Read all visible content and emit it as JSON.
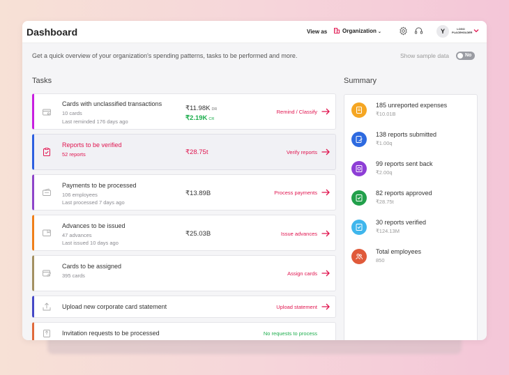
{
  "header": {
    "title": "Dashboard",
    "view_as_label": "View as",
    "org_select_value": "Organization",
    "avatar_initial": "Y",
    "logo_text_top": "LOGO",
    "logo_text_bottom": "PLACEHOLDER"
  },
  "intro": {
    "subtitle": "Get a quick overview of your organization's spending patterns, tasks to be performed and more.",
    "sample_data_label": "Show sample data",
    "sample_toggle_text": "No"
  },
  "tasks": {
    "title": "Tasks",
    "items": [
      {
        "title": "Cards with unclassified transactions",
        "line1": "10 cards",
        "line2": "Last reminded 176 days ago",
        "amount": "₹11.98K",
        "amount_suffix": "DR",
        "amount2": "₹2.19K",
        "amount2_suffix": "CR",
        "action": "Remind / Classify",
        "accent": "#c81ee0",
        "icon": "card-icon"
      },
      {
        "title": "Reports to be verified",
        "line1": "52 reports",
        "amount": "₹28.75t",
        "action": "Verify reports",
        "accent": "#2d5fe0",
        "icon": "clipboard-check-icon"
      },
      {
        "title": "Payments to be processed",
        "line1": "106 employees",
        "line2": "Last processed 7 days ago",
        "amount": "₹13.89B",
        "action": "Process payments",
        "accent": "#8e44c9",
        "icon": "wallet-icon"
      },
      {
        "title": "Advances to be issued",
        "line1": "47 advances",
        "line2": "Last issued 10 days ago",
        "amount": "₹25.03B",
        "action": "Issue advances",
        "accent": "#ef7f1a",
        "icon": "advance-icon"
      },
      {
        "title": "Cards to be assigned",
        "line1": "395 cards",
        "action": "Assign cards",
        "accent": "#a39061",
        "icon": "card-edit-icon"
      },
      {
        "title": "Upload new corporate card statement",
        "action": "Upload statement",
        "accent": "#4548c6",
        "icon": "upload-icon"
      },
      {
        "title": "Invitation requests to be processed",
        "action": "No requests to process",
        "action_color": "#1eae4e",
        "accent": "#e06a3c",
        "icon": "invite-icon"
      }
    ]
  },
  "summary": {
    "title": "Summary",
    "items": [
      {
        "label": "185 unreported expenses",
        "value": "₹10.01B",
        "color": "#f5a623",
        "icon": "receipt-icon"
      },
      {
        "label": "138 reports submitted",
        "value": "₹1.00q",
        "color": "#2d6ae0",
        "icon": "report-submit-icon"
      },
      {
        "label": "99 reports sent back",
        "value": "₹2.00q",
        "color": "#8e3ed6",
        "icon": "report-back-icon"
      },
      {
        "label": "82 reports approved",
        "value": "₹28.75t",
        "color": "#22a04b",
        "icon": "report-approved-icon"
      },
      {
        "label": "30 reports verified",
        "value": "₹124.13M",
        "color": "#3fb6ec",
        "icon": "report-verified-icon"
      },
      {
        "label": "Total employees",
        "value": "850",
        "color": "#e05a3a",
        "icon": "people-icon"
      }
    ]
  },
  "colors": {
    "brand_pink": "#e0154f",
    "success_green": "#1eae4e"
  }
}
